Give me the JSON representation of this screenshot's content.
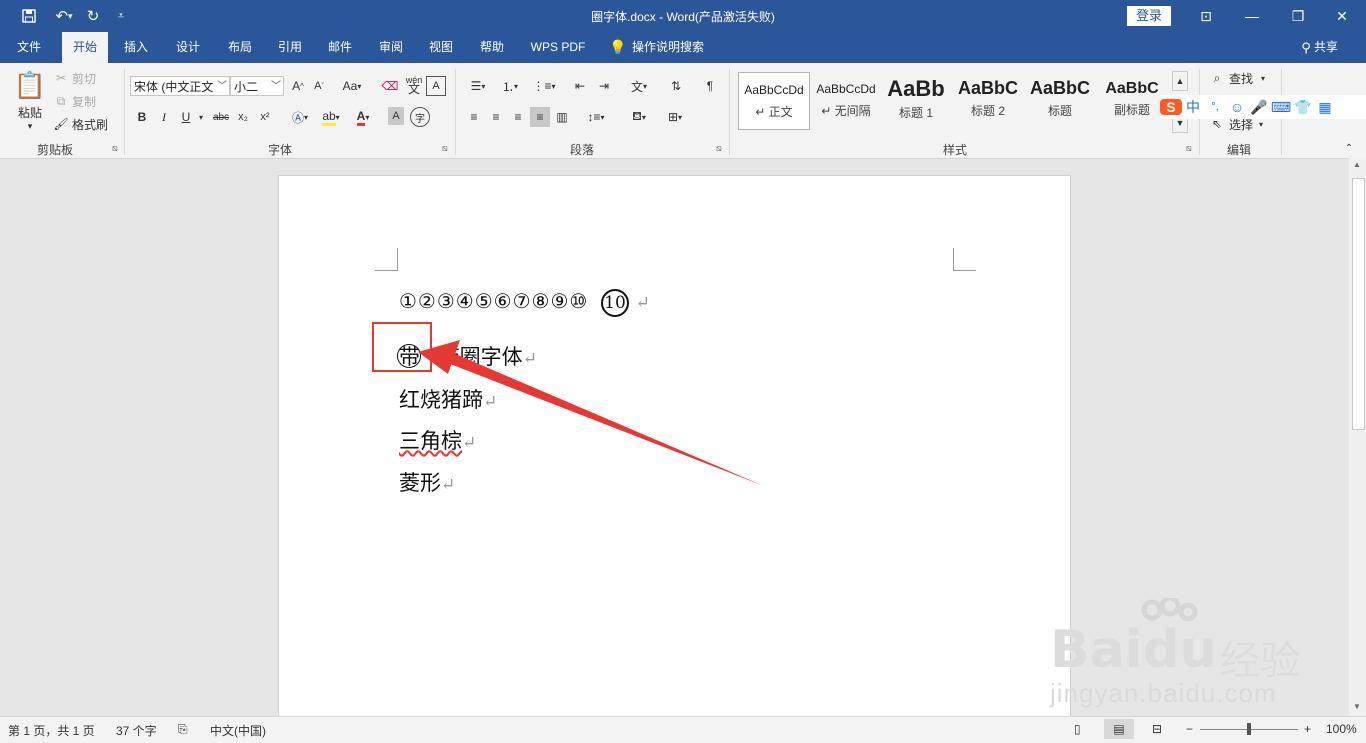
{
  "titlebar": {
    "title": "圈字体.docx  -  Word(产品激活失败)",
    "login": "登录",
    "qa_icons": [
      "save-icon",
      "undo-icon",
      "redo-icon",
      "customize-icon"
    ]
  },
  "tabs": [
    {
      "label": "文件",
      "active": false
    },
    {
      "label": "开始",
      "active": true
    },
    {
      "label": "插入",
      "active": false
    },
    {
      "label": "设计",
      "active": false
    },
    {
      "label": "布局",
      "active": false
    },
    {
      "label": "引用",
      "active": false
    },
    {
      "label": "邮件",
      "active": false
    },
    {
      "label": "审阅",
      "active": false
    },
    {
      "label": "视图",
      "active": false
    },
    {
      "label": "帮助",
      "active": false
    },
    {
      "label": "WPS PDF",
      "active": false
    }
  ],
  "tell_me": "操作说明搜索",
  "share": "共享",
  "clipboard": {
    "paste": "粘贴",
    "cut": "剪切",
    "copy": "复制",
    "format_painter": "格式刷",
    "group": "剪贴板"
  },
  "font": {
    "name": "宋体 (中文正文",
    "size": "小二",
    "group": "字体",
    "aa_label": "Aa",
    "wen_label": "wén",
    "bold": "B",
    "italic": "I",
    "underline": "U",
    "strike": "abc",
    "subscript": "x₂",
    "superscript": "x²"
  },
  "paragraph": {
    "group": "段落"
  },
  "styles": {
    "group": "样式",
    "items": [
      {
        "sample": "AaBbCcDd",
        "name": "↵ 正文"
      },
      {
        "sample": "AaBbCcDd",
        "name": "↵ 无间隔"
      },
      {
        "sample": "AaBb",
        "name": "标题 1"
      },
      {
        "sample": "AaBbC",
        "name": "标题 2"
      },
      {
        "sample": "AaBbC",
        "name": "标题"
      },
      {
        "sample": "AaBbC",
        "name": "副标题"
      }
    ]
  },
  "editing": {
    "find": "查找",
    "select": "选择",
    "group": "编辑"
  },
  "ime": {
    "mode": "中",
    "punct": "°,"
  },
  "document": {
    "circle_nums": "①②③④⑤⑥⑦⑧⑨⑩",
    "circle_ten": "10",
    "circled_char": "带",
    "line2_rest": "带圈字体",
    "line3": "红烧猪蹄",
    "line4": "三角棕",
    "line5": "菱形",
    "para_mark": "↵"
  },
  "watermark": {
    "brand": "Baidu",
    "jingyan": "经验",
    "url": "jingyan.baidu.com"
  },
  "status": {
    "page": "第 1 页，共 1 页",
    "words": "37 个字",
    "language": "中文(中国)",
    "zoom": "100%",
    "zoom_level": 100
  },
  "colors": {
    "brand": "#2b579a",
    "highlight": "#e53935"
  }
}
